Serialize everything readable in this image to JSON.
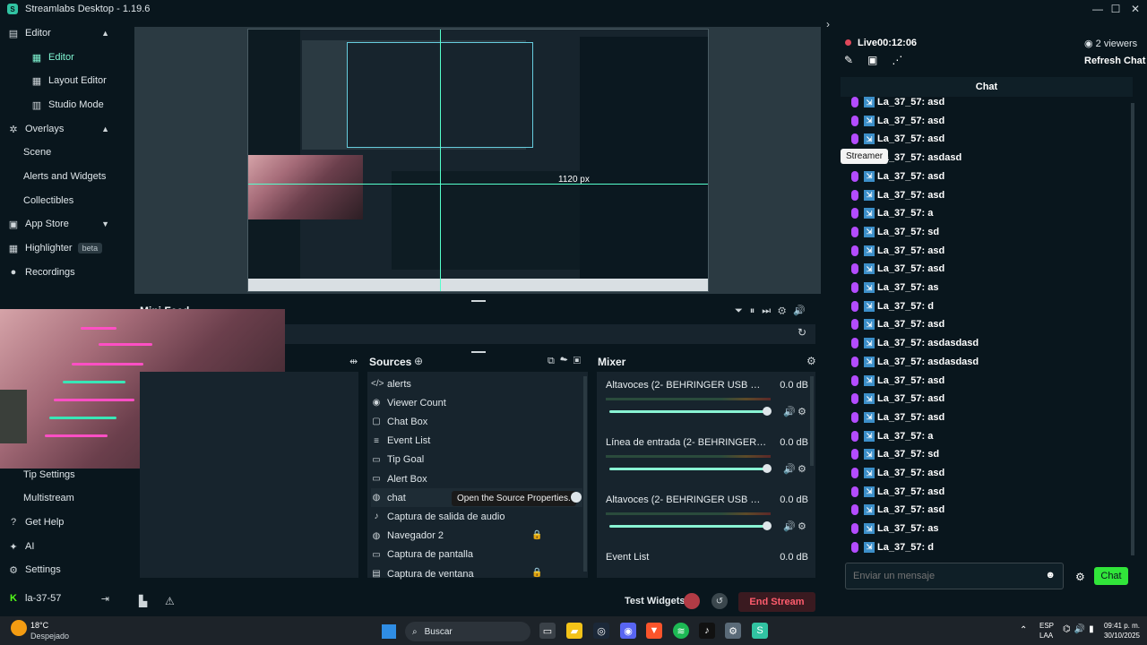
{
  "window": {
    "title": "Streamlabs Desktop - 1.19.6"
  },
  "sidebar": {
    "editor_section": "Editor",
    "editor": "Editor",
    "layout_editor": "Layout Editor",
    "studio_mode": "Studio Mode",
    "overlays_section": "Overlays",
    "scene": "Scene",
    "alerts_widgets": "Alerts and Widgets",
    "collectibles": "Collectibles",
    "app_store": "App Store",
    "highlighter": "Highlighter",
    "highlighter_badge": "beta",
    "recordings": "Recordings",
    "tip_settings": "Tip Settings",
    "multistream": "Multistream",
    "get_help": "Get Help",
    "ai": "AI",
    "settings": "Settings",
    "account": "la-37-57"
  },
  "preview": {
    "measure_label": "1120 px"
  },
  "scene_label": "Mini Feed",
  "sources": {
    "title": "Sources",
    "items": [
      {
        "label": "alerts",
        "icon": "code-icon"
      },
      {
        "label": "Viewer Count",
        "icon": "eye-icon"
      },
      {
        "label": "Chat Box",
        "icon": "chat-icon"
      },
      {
        "label": "Event List",
        "icon": "list-icon"
      },
      {
        "label": "Tip Goal",
        "icon": "goal-icon"
      },
      {
        "label": "Alert Box",
        "icon": "alert-box-icon"
      },
      {
        "label": "chat",
        "icon": "globe-icon"
      },
      {
        "label": "Captura de salida de audio",
        "icon": "speaker-icon"
      },
      {
        "label": "Navegador 2",
        "icon": "globe-icon"
      },
      {
        "label": "Captura de pantalla",
        "icon": "monitor-icon"
      },
      {
        "label": "Captura de ventana",
        "icon": "window-icon"
      }
    ],
    "tooltip": "Open the Source Properties."
  },
  "mixer": {
    "title": "Mixer",
    "rows": [
      {
        "name": "Altavoces (2- BEHRINGER USB WDM AUDI...",
        "db": "0.0 dB"
      },
      {
        "name": "Línea de entrada (2- BEHRINGER USB WD...",
        "db": "0.0 dB"
      },
      {
        "name": "Altavoces (2- BEHRINGER USB WDM AUDI...",
        "db": "0.0 dB"
      },
      {
        "name": "Event List",
        "db": "0.0 dB"
      }
    ]
  },
  "footer": {
    "test_widgets": "Test Widgets",
    "end_stream": "End Stream"
  },
  "chat": {
    "live": "Live",
    "timer": "00:12:06",
    "viewers": "2 viewers",
    "refresh": "Refresh Chat",
    "header": "Chat",
    "streamer_tooltip": "Streamer",
    "messages": [
      "La_37_57: asd",
      "La_37_57: asd",
      "La_37_57: asd",
      "La_37_57: asdasd",
      "La_37_57: asd",
      "La_37_57: asd",
      "La_37_57: a",
      "La_37_57: sd",
      "La_37_57: asd",
      "La_37_57: asd",
      "La_37_57: as",
      "La_37_57: d",
      "La_37_57: asd",
      "La_37_57: asdasdasd",
      "La_37_57: asdasdasd",
      "La_37_57: asd",
      "La_37_57: asd",
      "La_37_57: asd",
      "La_37_57: a",
      "La_37_57: sd",
      "La_37_57: asd",
      "La_37_57: asd",
      "La_37_57: asd",
      "La_37_57: as",
      "La_37_57: d"
    ],
    "input_placeholder": "Enviar un mensaje",
    "send": "Chat"
  },
  "taskbar": {
    "weather_temp": "18°C",
    "weather_desc": "Despejado",
    "search": "Buscar",
    "lang": "ESP",
    "region": "LAA",
    "time": "09:41 p. m.",
    "date": "30/10/2025"
  },
  "colors": {
    "accent": "#80f5d2",
    "live_red": "#e0485a",
    "send_green": "#31e53a"
  }
}
